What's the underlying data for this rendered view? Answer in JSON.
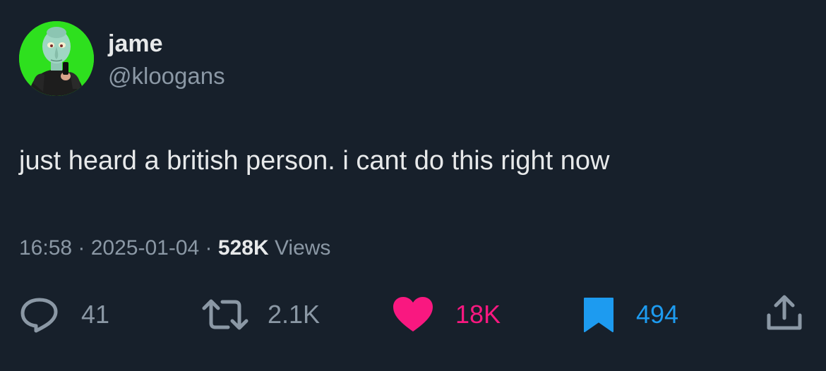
{
  "author": {
    "display_name": "jame",
    "handle": "@kloogans"
  },
  "tweet": {
    "text": "just heard a british person. i cant do this right now"
  },
  "meta": {
    "time": "16:58",
    "separator1": " · ",
    "date": "2025-01-04",
    "separator2": " · ",
    "views_count": "528K",
    "views_label": " Views"
  },
  "actions": {
    "reply": {
      "count": "41",
      "icon": "reply-icon"
    },
    "retweet": {
      "count": "2.1K",
      "icon": "retweet-icon"
    },
    "like": {
      "count": "18K",
      "icon": "heart-icon"
    },
    "bookmark": {
      "count": "494",
      "icon": "bookmark-icon"
    },
    "share": {
      "icon": "share-icon"
    }
  },
  "colors": {
    "background": "#17202b",
    "primary_text": "#e7e9ea",
    "secondary_text": "#8b98a5",
    "like": "#f91880",
    "bookmark": "#1d9bf0",
    "avatar_background": "#2ee01e"
  }
}
